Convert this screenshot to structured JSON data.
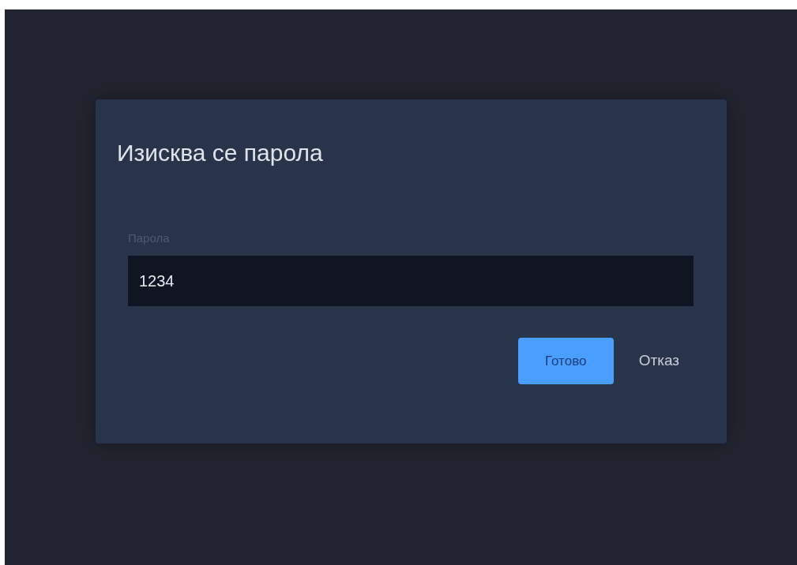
{
  "dialog": {
    "title": "Изисква се парола",
    "field": {
      "label": "Парола",
      "value": "1234"
    },
    "buttons": [
      {
        "label": "Готово",
        "kind": "primary"
      },
      {
        "label": "Отказ",
        "kind": "link"
      }
    ]
  }
}
